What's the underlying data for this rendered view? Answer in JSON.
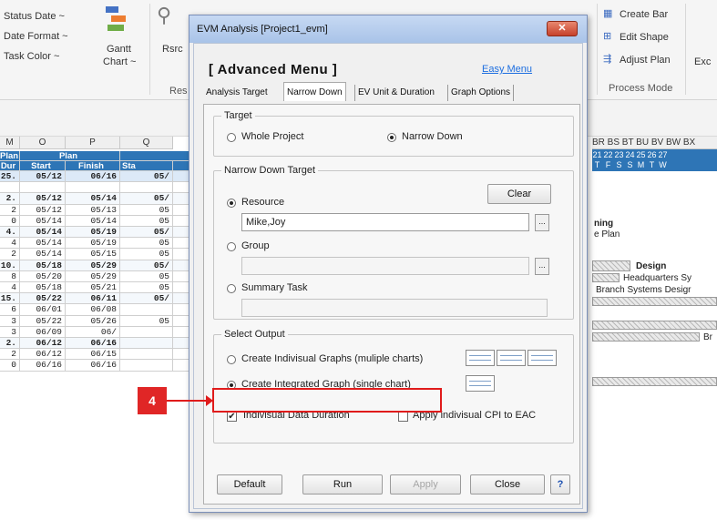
{
  "ribbon": {
    "status_date": "Status Date ~",
    "date_format": "Date Format ~",
    "task_color": "Task Color ~",
    "gantt_chart_line1": "Gantt",
    "gantt_chart_line2": "Chart ~",
    "rsrc": "Rsrc",
    "res": "Res",
    "create_bar": "Create Bar",
    "edit_shape": "Edit Shape",
    "adjust_plan": "Adjust Plan",
    "process_mode": "Process Mode",
    "exc": "Exc"
  },
  "sheet": {
    "col_letters": [
      "M",
      "O",
      "P",
      "Q"
    ],
    "header_row1": [
      "Plan",
      "Plan"
    ],
    "header_row2": [
      "Dur",
      "Start",
      "Finish",
      "Sta"
    ],
    "rows": [
      {
        "dur": "25.",
        "start": "05/12",
        "finish": "06/16",
        "q": "05/",
        "style": "blue"
      },
      {
        "dur": "",
        "start": "",
        "finish": "",
        "q": "",
        "style": "blank"
      },
      {
        "dur": "2.",
        "start": "05/12",
        "finish": "05/14",
        "q": "05/",
        "style": "bold"
      },
      {
        "dur": "2",
        "start": "05/12",
        "finish": "05/13",
        "q": "05",
        "style": "normal"
      },
      {
        "dur": "0",
        "start": "05/14",
        "finish": "05/14",
        "q": "05",
        "style": "normal"
      },
      {
        "dur": "4.",
        "start": "05/14",
        "finish": "05/19",
        "q": "05/",
        "style": "bold"
      },
      {
        "dur": "4",
        "start": "05/14",
        "finish": "05/19",
        "q": "05",
        "style": "normal"
      },
      {
        "dur": "2",
        "start": "05/14",
        "finish": "05/15",
        "q": "05",
        "style": "normal"
      },
      {
        "dur": "10.",
        "start": "05/18",
        "finish": "05/29",
        "q": "05/",
        "style": "bold"
      },
      {
        "dur": "8",
        "start": "05/20",
        "finish": "05/29",
        "q": "05",
        "style": "normal"
      },
      {
        "dur": "4",
        "start": "05/18",
        "finish": "05/21",
        "q": "05",
        "style": "normal"
      },
      {
        "dur": "15.",
        "start": "05/22",
        "finish": "06/11",
        "q": "05/",
        "style": "bold"
      },
      {
        "dur": "6",
        "start": "06/01",
        "finish": "06/08",
        "q": "",
        "style": "normal"
      },
      {
        "dur": "3",
        "start": "05/22",
        "finish": "05/26",
        "q": "05",
        "style": "normal"
      },
      {
        "dur": "3",
        "start": "06/09",
        "finish": "06/",
        "q": "",
        "style": "normal"
      },
      {
        "dur": "2.",
        "start": "06/12",
        "finish": "06/16",
        "q": "",
        "style": "bold"
      },
      {
        "dur": "2",
        "start": "06/12",
        "finish": "06/15",
        "q": "",
        "style": "normal"
      },
      {
        "dur": "0",
        "start": "06/16",
        "finish": "06/16",
        "q": "",
        "style": "normal"
      }
    ]
  },
  "gantt": {
    "col_letters": "BR BS BT BU BV BW BX",
    "days": [
      "21",
      "22",
      "23",
      "24",
      "25",
      "26",
      "27"
    ],
    "weekdays": [
      "T",
      "F",
      "S",
      "S",
      "M",
      "T",
      "W"
    ],
    "text_ning": "ning",
    "text_plan": "e Plan",
    "text_design": "Design",
    "text_hq": "Headquarters Sy",
    "text_branch": "Branch Systems Desigr",
    "text_br": "Br"
  },
  "dialog": {
    "title": "EVM Analysis  [Project1_evm]",
    "close_label": "✕",
    "advanced_menu": "[ Advanced Menu ]",
    "easy_menu": "Easy Menu",
    "tabs": [
      "Analysis Target",
      "Narrow Down",
      "EV Unit & Duration",
      "Graph Options"
    ],
    "target": {
      "label": "Target",
      "whole_project": "Whole Project",
      "narrow_down": "Narrow Down"
    },
    "narrow_target": {
      "label": "Narrow Down Target",
      "clear": "Clear",
      "resource": "Resource",
      "resource_value": "Mike,Joy",
      "group": "Group",
      "group_value": "",
      "summary_task": "Summary Task",
      "summary_value": "",
      "ellipsis": "..."
    },
    "output": {
      "label": "Select Output",
      "individual": "Create Indivisual Graphs (muliple charts)",
      "integrated": "Create Integrated Graph (single chart)",
      "individual_duration": "Indivisual Data Duration",
      "apply_cpi": "Apply indivisual CPI to EAC"
    },
    "buttons": {
      "default": "Default",
      "run": "Run",
      "apply": "Apply",
      "close": "Close",
      "help": "?"
    }
  },
  "annotation": {
    "step_number": "4",
    "color": "#e01b1b"
  }
}
